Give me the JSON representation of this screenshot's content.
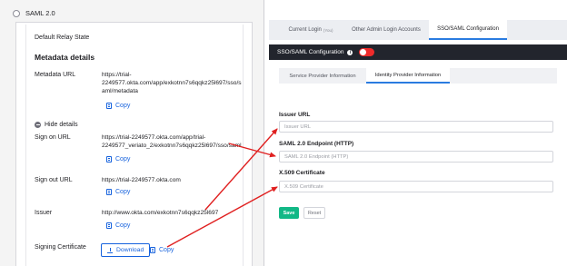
{
  "okta": {
    "section_title": "SAML 2.0",
    "default_relay_state_label": "Default Relay State",
    "metadata_heading": "Metadata details",
    "metadata_url_label": "Metadata URL",
    "metadata_url_lines": [
      "https://trial-",
      "2249577.okta.com/app/exkotnn7s6qqkz25l697/sso/s",
      "aml/metadata"
    ],
    "copy_label": "Copy",
    "hide_details_label": "Hide details",
    "sign_on_url_label": "Sign on URL",
    "sign_on_url_lines": [
      "https://trial-2249577.okta.com/app/trial-",
      "2249577_veriato_2/exkotnn7s6qqkz25l697/sso/saml"
    ],
    "sign_out_url_label": "Sign out URL",
    "sign_out_url": "https://trial-2249577.okta.com",
    "issuer_label": "Issuer",
    "issuer_value": "http://www.okta.com/exkotnn7s6qqkz25l697",
    "signing_certificate_label": "Signing Certificate",
    "download_label": "Download"
  },
  "admin": {
    "tabs": [
      {
        "label": "Current Login",
        "note": "(You)"
      },
      {
        "label": "Other Admin Login Accounts",
        "note": ""
      },
      {
        "label": "SSO/SAML Configuration",
        "note": ""
      }
    ],
    "sso_bar_label": "SSO/SAML Configuration",
    "sso_enabled": true,
    "subtabs": [
      "Service Provider Information",
      "Identity Provider Information"
    ],
    "issuer_url_label": "Issuer URL",
    "issuer_url_placeholder": "Issuer URL",
    "endpoint_label": "SAML 2.0 Endpoint (HTTP)",
    "endpoint_placeholder": "SAML 2.0 Endpoint (HTTP)",
    "cert_label": "X.509 Certificate",
    "cert_placeholder": "X.509 Certificate",
    "save_label": "Save",
    "reset_label": "Reset"
  },
  "colors": {
    "link_blue": "#1662dd",
    "arrow_red": "#e02020",
    "toggle_red": "#ef2b2b",
    "save_green": "#12b886",
    "dark_bar": "#22252d"
  }
}
